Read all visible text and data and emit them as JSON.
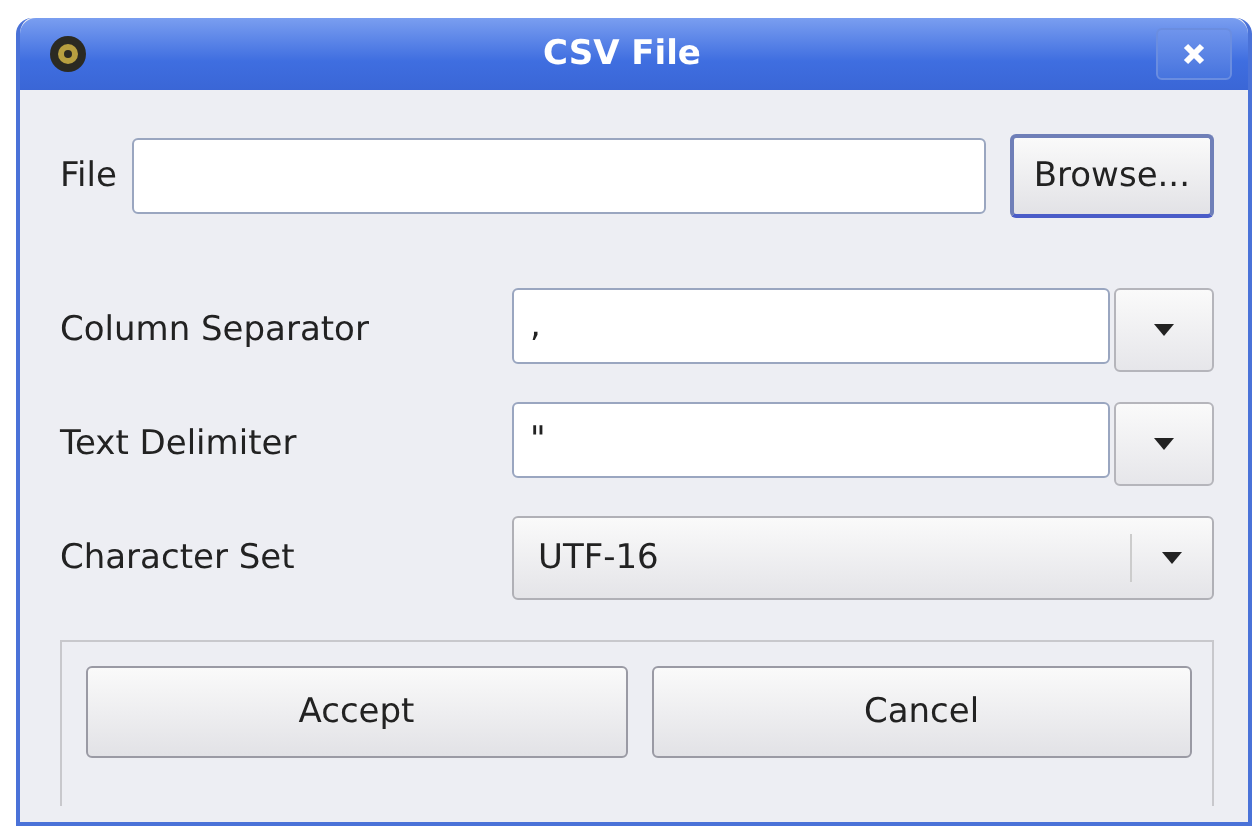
{
  "window": {
    "title": "CSV File"
  },
  "file": {
    "label": "File",
    "button": "Browse..."
  },
  "fields": [
    {
      "label": "Column Separator",
      "value": ",",
      "kind": "combo"
    },
    {
      "label": "Text Delimiter",
      "value": "\"",
      "kind": "combo"
    },
    {
      "label": "Character Set",
      "value": "UTF-16",
      "kind": "select"
    }
  ],
  "buttons": [
    "Accept",
    "Cancel"
  ]
}
